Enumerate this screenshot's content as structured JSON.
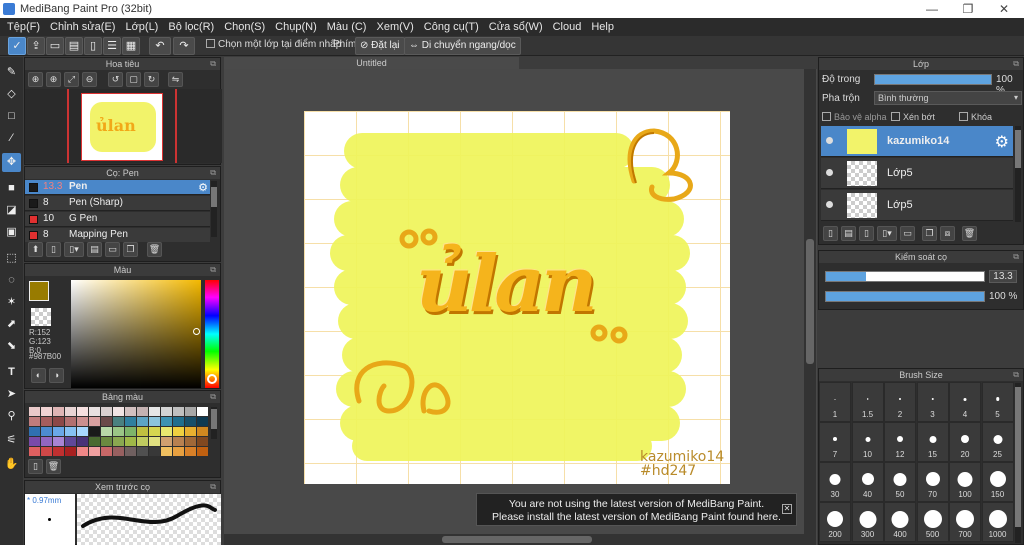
{
  "window": {
    "title": "MediBang Paint Pro (32bit)",
    "controls": {
      "minimize": "—",
      "maximize": "❐",
      "close": "✕"
    }
  },
  "menu": [
    "Tệp(F)",
    "Chỉnh sửa(E)",
    "Lớp(L)",
    "Bộ lọc(R)",
    "Chọn(S)",
    "Chụp(N)",
    "Màu (C)",
    "Xem(V)",
    "Công cụ(T)",
    "Cửa sổ(W)",
    "Cloud",
    "Help"
  ],
  "toolbar": {
    "sample_one_layer": "Chọn một lớp tại điểm nhấp",
    "key_label": "Phím",
    "reset_label": "Đặt lại",
    "move_label": "Di chuyển ngang/dọc"
  },
  "navigator": {
    "title": "Hoa tiêu"
  },
  "brush_panel": {
    "title": "Cọ: Pen",
    "brushes": [
      {
        "size": "13.3",
        "name": "Pen",
        "color": "#1a1a1a",
        "selected": true
      },
      {
        "size": "8",
        "name": "Pen (Sharp)",
        "color": "#1a1a1a",
        "selected": false
      },
      {
        "size": "10",
        "name": "G Pen",
        "color": "#e03030",
        "selected": false
      },
      {
        "size": "8",
        "name": "Mapping Pen",
        "color": "#e03030",
        "selected": false
      }
    ]
  },
  "color_panel": {
    "title": "Màu",
    "rgb": {
      "r": "R:152",
      "g": "G:123",
      "b": "B:0"
    },
    "hex": "#987B00",
    "foreground": "#987b00"
  },
  "palette_panel": {
    "title": "Bảng màu",
    "swatches": [
      "#e9c9c9",
      "#f0d2d2",
      "#dfb5b5",
      "#e8d4d4",
      "#f5e0e0",
      "#e8e1e1",
      "#d9cfcf",
      "#f1e4e4",
      "#d2c0c0",
      "#c5b2b2",
      "#e6e6e6",
      "#d4d4d4",
      "#c0c0c0",
      "#a8a8a8",
      "#ffffff",
      "#c07c7c",
      "#a55d5d",
      "#8c4848",
      "#b27070",
      "#cc8f8f",
      "#d8a0a0",
      "#6a4949",
      "#4a8080",
      "#2f7fa0",
      "#5da4c4",
      "#8cc4dc",
      "#3e93b3",
      "#1f6e8e",
      "#174f6a",
      "#0e3a52",
      "#3070b0",
      "#4c8cd0",
      "#6aa8e8",
      "#86c2f4",
      "#a8d8ff",
      "#1a1a1a",
      "#b8d8a8",
      "#9bc686",
      "#7eb46a",
      "#c0c040",
      "#d6d650",
      "#e8e870",
      "#f0d040",
      "#e8b030",
      "#d08820",
      "#7a4aa8",
      "#9266c0",
      "#a884d4",
      "#60489a",
      "#483278",
      "#4a6a30",
      "#6a8a40",
      "#8aa850",
      "#a0b848",
      "#c0cc60",
      "#e0e080",
      "#d0a070",
      "#b88050",
      "#a06838",
      "#804820",
      "#e06060",
      "#d04848",
      "#c03030",
      "#a82020",
      "#f08888",
      "#f0a0a0",
      "#c86868",
      "#986060",
      "#706060",
      "#505050",
      "#383838",
      "#f0c060",
      "#e8a040",
      "#d88028",
      "#c06010"
    ]
  },
  "brush_preview": {
    "title": "Xem trước cọ",
    "size": "* 0.97mm"
  },
  "canvas": {
    "tab": "Untitled",
    "art_text": "ủlan",
    "signature1": "kazumiko14",
    "signature2": "#hd247"
  },
  "layer_panel": {
    "title": "Lớp",
    "opacity_label": "Độ trong",
    "opacity_value": "100 %",
    "opacity_pct": 100,
    "blend_label": "Pha trộn",
    "blend_value": "Bình thường",
    "protect_alpha": "Bảo vệ alpha",
    "clipping": "Xén bớt",
    "lock": "Khóa",
    "layers": [
      {
        "name": "kazumiko14",
        "selected": true
      },
      {
        "name": "Lớp5",
        "selected": false
      },
      {
        "name": "Lớp5",
        "selected": false
      }
    ]
  },
  "brush_control": {
    "title": "Kiểm soát cọ",
    "size_value": "13.3",
    "size_fraction": 0.25,
    "opacity_value": "100 %",
    "opacity_pct": 100
  },
  "brush_size_panel": {
    "title": "Brush Size",
    "sizes": [
      "1",
      "1.5",
      "2",
      "3",
      "4",
      "5",
      "7",
      "10",
      "12",
      "15",
      "20",
      "25",
      "30",
      "40",
      "50",
      "70",
      "100",
      "150",
      "200",
      "300",
      "400",
      "500",
      "700",
      "1000"
    ]
  },
  "update_notice": {
    "line1": "You are not using the latest version of MediBang Paint.",
    "line2": "Please install the latest version of MediBang Paint found here.",
    "close": "✕"
  },
  "icons": [
    "pen-icon",
    "eraser-icon",
    "rect-icon",
    "brush-icon",
    "move-icon",
    "fill-icon",
    "bucket-icon",
    "gradient-icon",
    "select-icon",
    "lasso-icon",
    "magic-wand-icon",
    "select-pen-icon",
    "select-eraser-icon",
    "text-icon",
    "operation-icon",
    "eyedropper-icon",
    "divide-icon",
    "hand-icon"
  ]
}
